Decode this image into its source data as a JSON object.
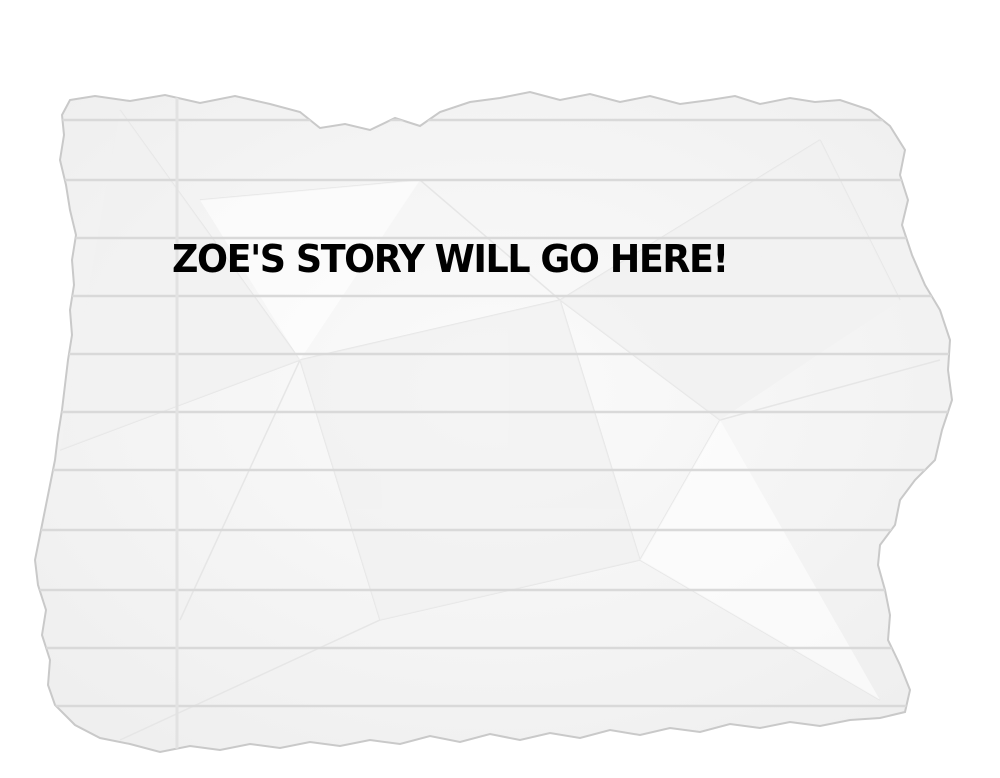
{
  "story": {
    "placeholder_text": "ZOE'S STORY WILL GO HERE!"
  },
  "paper": {
    "icon": "torn-lined-paper",
    "fill_color": "#f7f7f7",
    "edge_color": "#c9c9c9",
    "rule_color": "#d9d9d9",
    "margin_line_color": "#e2e2e2",
    "crease_color": "#ececec",
    "background_color": "#ffffff",
    "text_color": "#000000"
  }
}
